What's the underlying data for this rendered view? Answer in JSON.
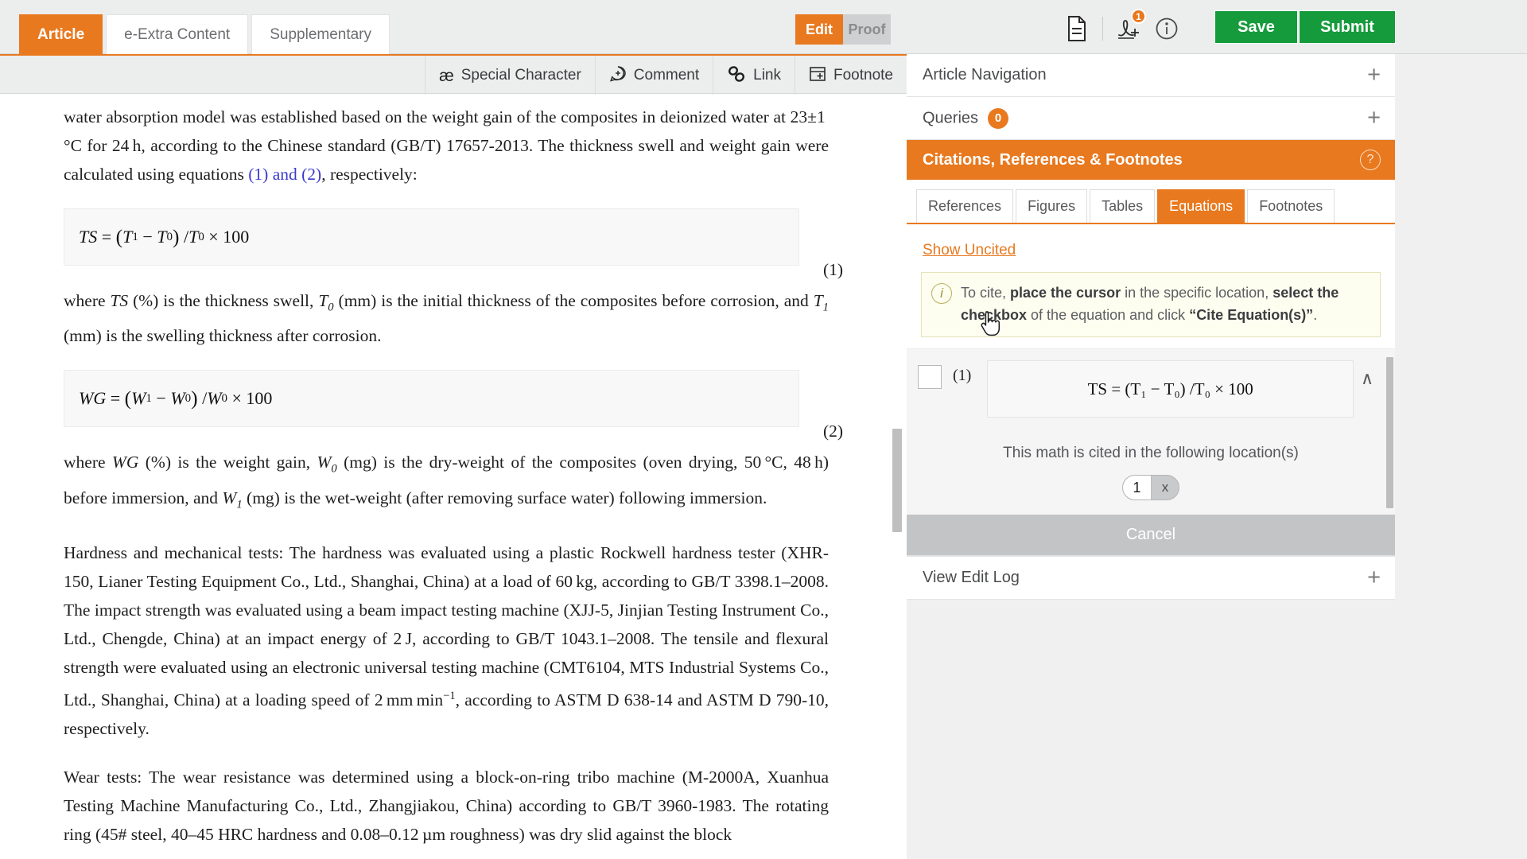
{
  "topbar": {
    "tabs": [
      {
        "label": "Article",
        "active": true
      },
      {
        "label": "e-Extra Content",
        "active": false
      },
      {
        "label": "Supplementary",
        "active": false
      }
    ],
    "mode": {
      "edit_label": "Edit",
      "proof_label": "Proof",
      "active": "Edit"
    },
    "icons": [
      {
        "name": "document-icon",
        "badge": ""
      },
      {
        "name": "signature-add-icon",
        "badge": "1"
      },
      {
        "name": "info-icon",
        "badge": ""
      }
    ],
    "save_label": "Save",
    "submit_label": "Submit",
    "accent_orange": "#e8791f",
    "accent_green": "#169b3c"
  },
  "editor_toolbar": {
    "tools": [
      {
        "label": "Special Character",
        "icon": "ae-ligature-icon",
        "glyph": "æ"
      },
      {
        "label": "Comment",
        "icon": "comment-plus-icon",
        "glyph": ""
      },
      {
        "label": "Link",
        "icon": "link-chain-icon",
        "glyph": ""
      },
      {
        "label": "Footnote",
        "icon": "footnote-icon",
        "glyph": ""
      }
    ]
  },
  "document": {
    "paragraphs": {
      "p1_a": "water absorption model was established based on the weight gain of the composites in deionized water at 23",
      "p1_pm": "±",
      "p1_b": "1 °C for 24 h, according to the Chinese standard (GB/T) 17657-2013. The thickness swell and weight gain were calculated using equations ",
      "p1_link": "(1) and (2)",
      "p1_c": ", respectively:",
      "p2_a": "where ",
      "p2_TS": "TS",
      "p2_b": " (%) is the thickness swell, ",
      "p2_T0": "T",
      "p2_T0sub": "0",
      "p2_c": " (mm) is the initial thickness of the composites before corrosion, and ",
      "p2_T1": "T",
      "p2_T1sub": "1",
      "p2_d": " (mm) is the swelling thickness after corrosion.",
      "p3_a": "where ",
      "p3_WG": "WG",
      "p3_b": " (%) is the weight gain, ",
      "p3_W0": "W",
      "p3_W0sub": "0",
      "p3_c": " (mg) is the dry-weight of the composites (oven drying, 50 °C, 48 h) before immersion, and ",
      "p3_W1": "W",
      "p3_W1sub": "1",
      "p3_d": " (mg) is the wet-weight (after removing surface water) following immersion.",
      "p4_a": "Hardness and mechanical tests: The hardness was evaluated using a plastic Rockwell hardness tester (XHR-150, Lianer Testing Equipment Co., Ltd., Shanghai, China) at a load of 60 kg, according to GB/T 3398.1–2008. The impact strength was evaluated using a beam impact testing machine (XJJ-5, Jinjian Testing Instrument Co., Ltd., Chengde, China) at an impact energy of 2 J, according to GB/T 1043.1–2008. The tensile and flexural strength were evaluated using an electronic universal testing machine (CMT6104, MTS Industrial Systems Co., Ltd., Shanghai, China) at a loading speed of 2 mm min",
      "p4_sup": "−1",
      "p4_b": ", according to ASTM D 638-14 and ASTM D 790-10, respectively.",
      "p5_a": "Wear tests: The wear resistance was determined using a block-on-ring tribo machine (M-2000A, Xuanhua Testing Machine Manufacturing Co., Ltd., Zhangjiakou, China) according to GB/T 3960-1983. The rotating ring (45# steel, 40–45 HRC hardness and 0.08–0.12 µm roughness) was dry slid against the block"
    },
    "equations": [
      {
        "number": "(1)",
        "lhs": "TS",
        "eq": "=",
        "body_open": "(",
        "var1": "T",
        "var1sub": "1",
        "minus": "−",
        "var2": "T",
        "var2sub": "0",
        "body_close": ")",
        "div": "/",
        "var3": "T",
        "var3sub": "0",
        "times": "×",
        "const": "100"
      },
      {
        "number": "(2)",
        "lhs": "WG",
        "eq": "=",
        "body_open": "(",
        "var1": "W",
        "var1sub": "1",
        "minus": "−",
        "var2": "W",
        "var2sub": "0",
        "body_close": ")",
        "div": "/",
        "var3": "W",
        "var3sub": "0",
        "times": "×",
        "const": "100"
      }
    ]
  },
  "right_panel": {
    "article_navigation": {
      "label": "Article Navigation",
      "expander": "+"
    },
    "queries": {
      "label": "Queries",
      "count": "0",
      "expander": "+"
    },
    "citations_section": {
      "title": "Citations, References & Footnotes",
      "help_glyph": "?"
    },
    "subtabs": [
      {
        "label": "References",
        "active": false
      },
      {
        "label": "Figures",
        "active": false
      },
      {
        "label": "Tables",
        "active": false
      },
      {
        "label": "Equations",
        "active": true
      },
      {
        "label": "Footnotes",
        "active": false
      }
    ],
    "show_uncited": "Show Uncited",
    "info_notice": {
      "icon": "info-italic-icon",
      "seg1": "To cite, ",
      "seg2_bold": "place the cursor",
      "seg3": " in the specific location, ",
      "seg4_bold": "select the checkbox",
      "seg5": " of the equation and click ",
      "seg6_bold": "“Cite Equation(s)”",
      "seg7": "."
    },
    "equation_item": {
      "checked": false,
      "number": "(1)",
      "preview": "TS = (T₁ − T₀) /T₀ × 100",
      "collapse_caret": "∧",
      "cited_note": "This math is cited in the following location(s)",
      "chips": [
        {
          "n": "1",
          "remove": "x"
        }
      ]
    },
    "cancel_label": "Cancel",
    "view_edit_log": {
      "label": "View Edit Log",
      "expander": "+"
    }
  }
}
